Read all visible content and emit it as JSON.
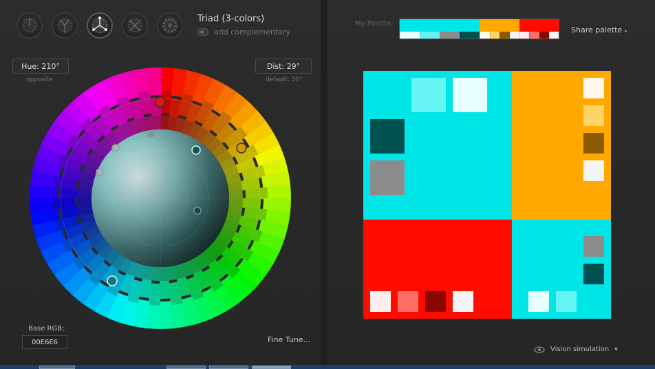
{
  "scheme": {
    "icons": [
      {
        "name": "mono-scheme-icon",
        "active": false
      },
      {
        "name": "complement-scheme-icon",
        "active": false
      },
      {
        "name": "triad-scheme-icon",
        "active": true
      },
      {
        "name": "tetrad-scheme-icon",
        "active": false
      },
      {
        "name": "analogic-scheme-icon",
        "active": false
      }
    ],
    "title": "Triad (3-colors)",
    "add_complementary": "add complementary"
  },
  "hue": {
    "label": "Hue: 210°",
    "sub": "opposite"
  },
  "dist": {
    "label": "Dist: 29°",
    "sub": "default: 30°"
  },
  "base_rgb": {
    "label": "Base RGB:",
    "value": "00E6E6"
  },
  "fine_tune": "Fine Tune...",
  "my_palette": {
    "label": "My Palette:",
    "groups": [
      {
        "main": "#00E6E6",
        "subs": [
          "#E6FFFF",
          "#66F3F3",
          "#8C8C8C",
          "#005050"
        ]
      },
      {
        "main": "#FFA800",
        "subs": [
          "#FFF8EB",
          "#FFD466",
          "#8C5A00",
          "#F4F4F4"
        ]
      },
      {
        "main": "#FF0C00",
        "subs": [
          "#FFECEC",
          "#FF6E66",
          "#8C0600",
          "#F4F4F4"
        ]
      }
    ]
  },
  "share_palette": "Share palette",
  "vision_simulation": "Vision simulation",
  "colors": {
    "cyan": "#00E6E6",
    "cyan_light": "#66F3F3",
    "cyan_pale": "#E6FFFF",
    "cyan_dark": "#005050",
    "gray": "#8C8C8C",
    "orange": "#FFA800",
    "orange_pale": "#FFF8EB",
    "orange_light": "#FFD466",
    "orange_dark": "#8C5A00",
    "red": "#FF0C00",
    "red_pale": "#FFECEC",
    "red_light": "#FF6E66",
    "red_dark": "#8C0600",
    "off_white": "#F4F4F4",
    "panel_bg": "#2a2a2a"
  }
}
